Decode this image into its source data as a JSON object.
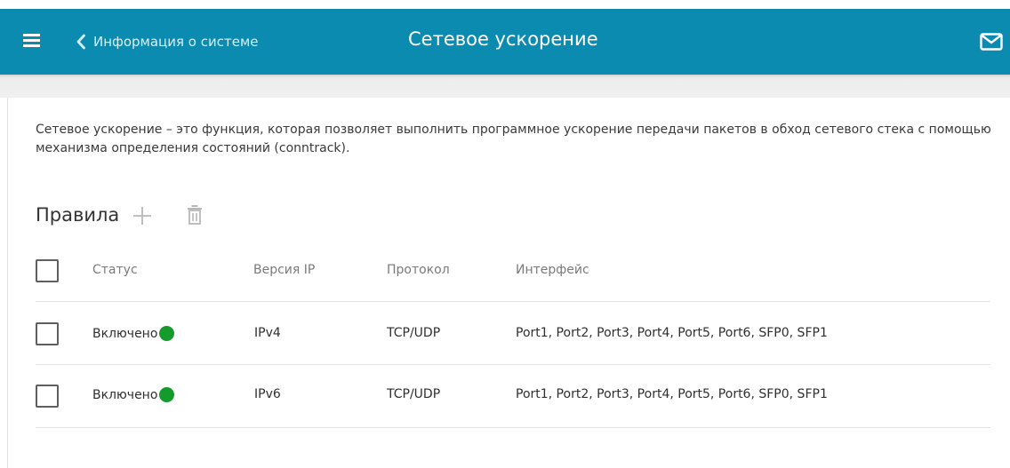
{
  "header": {
    "back_label": "Информация о системе",
    "title": "Сетевое ускорение",
    "background_color": "#0b8bb0"
  },
  "icons": {
    "menu": "hamburger-menu-icon",
    "back": "chevron-left-icon",
    "mail": "envelope-icon",
    "add": "plus-icon",
    "delete": "trash-icon"
  },
  "main": {
    "description": "Сетевое ускорение – это функция, которая позволяет выполнить программное ускорение передачи пакетов в обход сетевого стека с помощью механизма определения состояний (conntrack).",
    "rules_title": "Правила"
  },
  "table": {
    "columns": [
      "Статус",
      "Версия IP",
      "Протокол",
      "Интерфейс"
    ],
    "rows": [
      {
        "status": "Включено",
        "status_color": "#159a2c",
        "ip_version": "IPv4",
        "protocol": "TCP/UDP",
        "interface": "Port1, Port2, Port3, Port4, Port5, Port6, SFP0, SFP1"
      },
      {
        "status": "Включено",
        "status_color": "#159a2c",
        "ip_version": "IPv6",
        "protocol": "TCP/UDP",
        "interface": "Port1, Port2, Port3, Port4, Port5, Port6, SFP0, SFP1"
      }
    ]
  }
}
